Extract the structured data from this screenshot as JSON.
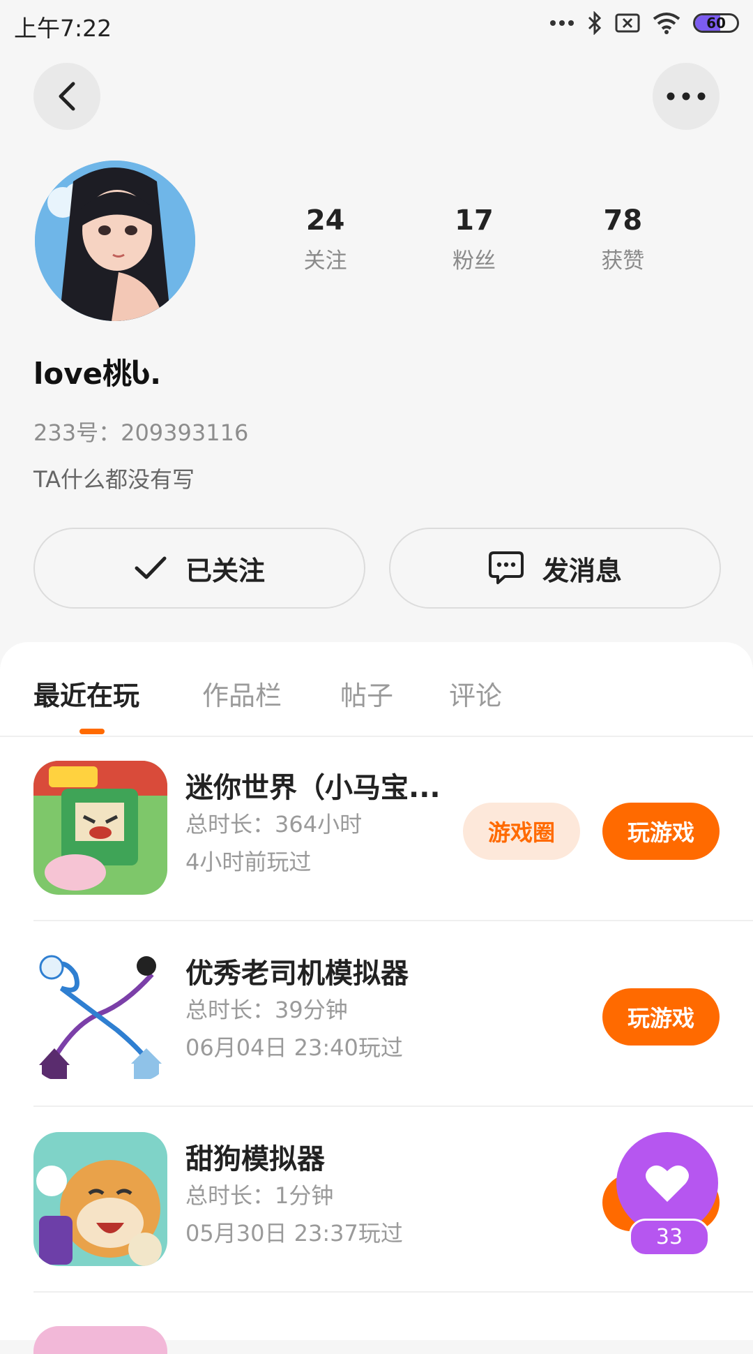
{
  "status_bar": {
    "time": "上午7:22",
    "battery": "60"
  },
  "profile": {
    "stats": [
      {
        "value": "24",
        "label": "关注"
      },
      {
        "value": "17",
        "label": "粉丝"
      },
      {
        "value": "78",
        "label": "获赞"
      }
    ],
    "nickname": "love桃Ⴑ.",
    "uid": "233号：209393116",
    "bio": "TA什么都没有写"
  },
  "actions": {
    "follow_label": "已关注",
    "message_label": "发消息"
  },
  "tabs": [
    {
      "label": "最近在玩",
      "active": true
    },
    {
      "label": "作品栏",
      "active": false
    },
    {
      "label": "帖子",
      "active": false
    },
    {
      "label": "评论",
      "active": false
    }
  ],
  "games": [
    {
      "title": "迷你世界（小马宝...",
      "playtime": "总时长：364小时",
      "last_played": "4小时前玩过",
      "circle_label": "游戏圈",
      "play_label": "玩游戏"
    },
    {
      "title": "优秀老司机模拟器",
      "playtime": "总时长：39分钟",
      "last_played": "06月04日 23:40玩过",
      "play_label": "玩游戏"
    },
    {
      "title": "甜狗模拟器",
      "playtime": "总时长：1分钟",
      "last_played": "05月30日 23:37玩过",
      "play_label": "玩游戏"
    }
  ],
  "floating": {
    "count": "33"
  },
  "colors": {
    "accent": "#ff6a00",
    "accent_light": "#fde8da",
    "float_purple": "#b656f0"
  }
}
